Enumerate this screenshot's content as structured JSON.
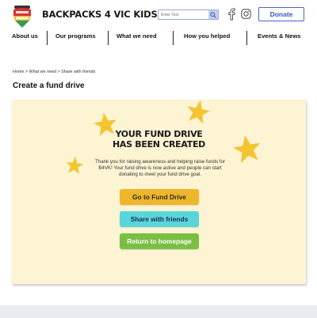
{
  "header": {
    "brand_name": "BACKPACKS 4 VIC KIDS",
    "logo_text": "BACKPACKS 4 VIC KIDS",
    "search": {
      "placeholder": "Enter Text",
      "icon": "search-icon"
    },
    "social": [
      "facebook-icon",
      "instagram-icon"
    ],
    "donate_label": "Donate"
  },
  "nav": {
    "items": [
      {
        "label": "About us"
      },
      {
        "label": "Our programs"
      },
      {
        "label": "What we need"
      },
      {
        "label": "How you helped"
      },
      {
        "label": "Events & News"
      }
    ]
  },
  "breadcrumb": {
    "home": "Home",
    "separator": ">",
    "parent": "What we need",
    "current": "Share with friends"
  },
  "page": {
    "title": "Create a fund drive"
  },
  "card": {
    "heading_line1": "YOUR FUND DRIVE",
    "heading_line2": "HAS BEEN CREATED",
    "message": "Thank you for raising awareness and helping raise funds for B4VK! Your fund drive is now active and people can start donating to meet your fund drive goal.",
    "buttons": {
      "fund_drive": "Go to Fund Drive",
      "share": "Share with friends",
      "home": "Return to homepage"
    }
  },
  "colors": {
    "accent_blue": "#3c56c0",
    "star_yellow": "#f5c431",
    "card_bg": "#fcf4d3",
    "fund_button": "#f0b62b",
    "share_button": "#59d6da",
    "home_button": "#79bf44"
  }
}
